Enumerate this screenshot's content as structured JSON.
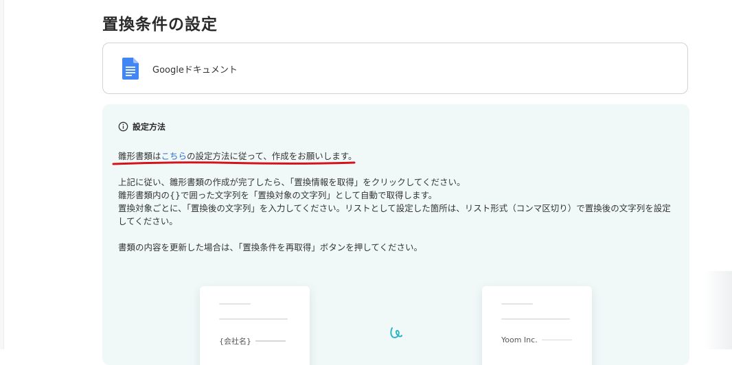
{
  "page": {
    "title": "置換条件の設定"
  },
  "app": {
    "name": "Googleドキュメント",
    "icon": "google-docs-icon",
    "icon_color": "#4285f4"
  },
  "info": {
    "icon": "info-icon",
    "title": "設定方法",
    "lead_prefix": "雛形書類は",
    "lead_link": "こちら",
    "lead_suffix": "の設定方法に従って、作成をお願いします。",
    "link_color": "#2f6fd6",
    "highlight_color": "#d4121a",
    "panel_bg": "#f1f9f8",
    "paragraphs": [
      "上記に従い、雛形書類の作成が完了したら、「置換情報を取得」をクリックしてください。",
      "雛形書類内の{}で囲った文字列を「置換対象の文字列」として自動で取得します。",
      "置換対象ごとに、「置換後の文字列」を入力してください。リストとして設定した箇所は、リスト形式（コンマ区切り）で置換後の文字列を設定してください。"
    ],
    "note": "書類の内容を更新した場合は、「置換条件を再取得」ボタンを押してください。"
  },
  "illustration": {
    "template_label": "{会社名}",
    "result_label": "Yoom Inc.",
    "arrow_icon": "swirl-arrow-icon",
    "arrow_color": "#2bb5c9"
  }
}
